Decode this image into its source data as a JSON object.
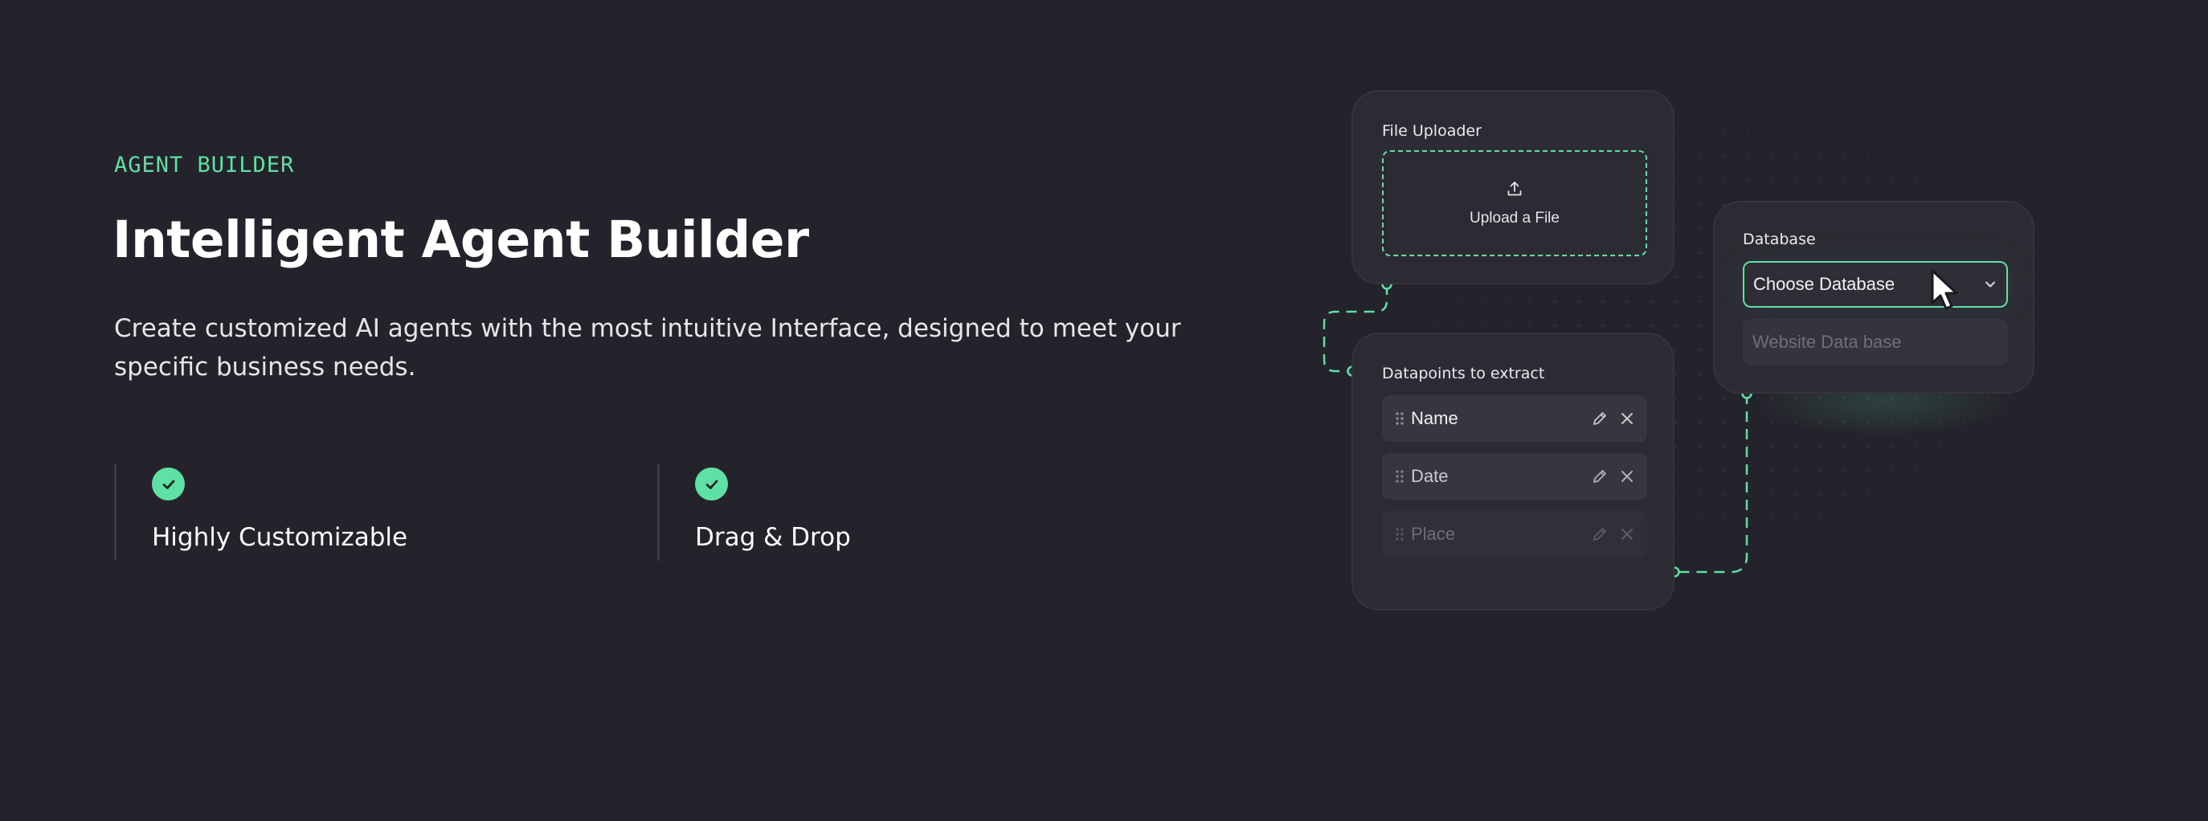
{
  "hero": {
    "eyebrow": "AGENT BUILDER",
    "title": "Intelligent Agent Builder",
    "description": "Create customized AI agents with the most intuitive Interface, designed to meet your specific business needs."
  },
  "features": [
    {
      "label": "Highly Customizable",
      "icon": "check-circle-icon"
    },
    {
      "label": "Drag & Drop",
      "icon": "check-circle-icon"
    }
  ],
  "file_uploader": {
    "title": "File Uploader",
    "upload_label": "Upload a File",
    "icon": "upload-icon"
  },
  "datapoints": {
    "title": "Datapoints to extract",
    "items": [
      {
        "label": "Name"
      },
      {
        "label": "Date"
      },
      {
        "label": "Place"
      }
    ]
  },
  "database": {
    "title": "Database",
    "selected": "Choose Database",
    "options": [
      "Website Data base"
    ]
  },
  "colors": {
    "accent": "#5fe0a4",
    "background": "#24232b",
    "card": "#2c2b33"
  }
}
